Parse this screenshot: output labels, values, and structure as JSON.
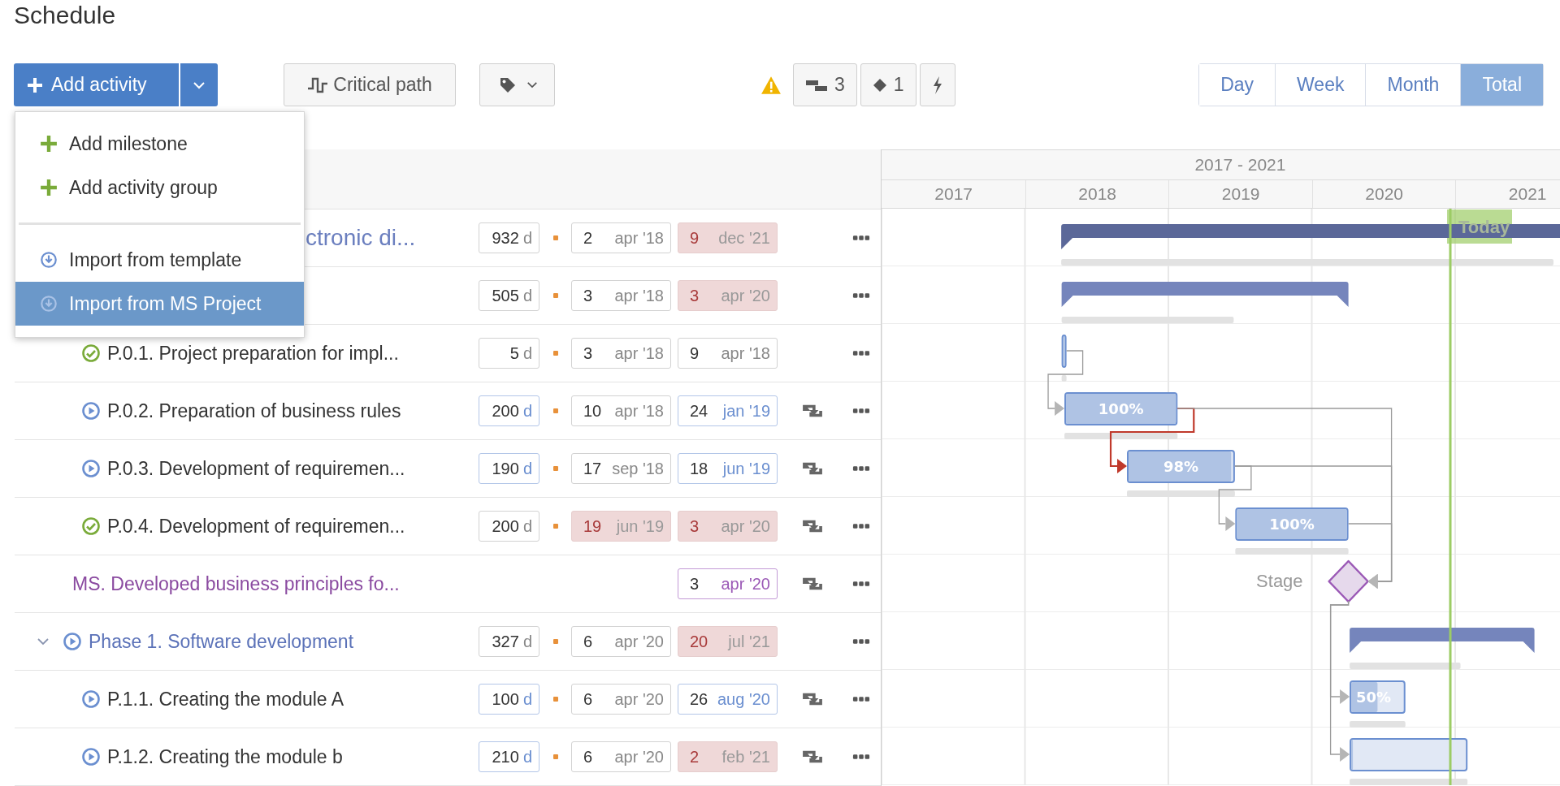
{
  "title": "Schedule",
  "toolbar": {
    "add_button": "Add activity",
    "critical_path": "Critical path",
    "counters": [
      {
        "kind": "bars",
        "count": "3"
      },
      {
        "kind": "milestone",
        "count": "1"
      },
      {
        "kind": "flash"
      }
    ],
    "views": [
      {
        "label": "Day",
        "selected": false
      },
      {
        "label": "Week",
        "selected": false
      },
      {
        "label": "Month",
        "selected": false
      },
      {
        "label": "Total",
        "selected": true
      }
    ]
  },
  "add_menu": {
    "groups": [
      [
        {
          "kind": "add",
          "label": "Add milestone",
          "selected": false
        },
        {
          "kind": "add",
          "label": "Add activity group",
          "selected": false
        }
      ],
      [
        {
          "kind": "import",
          "label": "Import from template",
          "selected": false
        },
        {
          "kind": "import",
          "label": "Import from MS Project",
          "selected": true
        }
      ]
    ]
  },
  "rows": [
    {
      "kind": "project",
      "name": "ctronic di...",
      "duration": {
        "value": "932",
        "unit": "d",
        "forecast": false
      },
      "start": {
        "day": "2",
        "month": "apr '18",
        "late": false,
        "forecast": false
      },
      "end": {
        "day": "9",
        "month": "dec '21",
        "late": true,
        "forecast": false
      },
      "repeat": false
    },
    {
      "kind": "group",
      "duration": {
        "value": "505",
        "unit": "d",
        "forecast": false
      },
      "start": {
        "day": "3",
        "month": "apr '18",
        "late": false,
        "forecast": false
      },
      "end": {
        "day": "3",
        "month": "apr '20",
        "late": true,
        "forecast": false
      },
      "repeat": false
    },
    {
      "kind": "task",
      "done": true,
      "name": "P.0.1. Project preparation for impl...",
      "duration": {
        "value": "5",
        "unit": "d",
        "forecast": false
      },
      "start": {
        "day": "3",
        "month": "apr '18",
        "late": false,
        "forecast": false
      },
      "end": {
        "day": "9",
        "month": "apr '18",
        "late": false,
        "forecast": false
      },
      "repeat": false,
      "bar": {
        "level": 1
      }
    },
    {
      "kind": "task",
      "done": false,
      "name": "P.0.2. Preparation of business rules",
      "duration": {
        "value": "200",
        "unit": "d",
        "forecast": true
      },
      "start": {
        "day": "10",
        "month": "apr '18",
        "late": false,
        "forecast": false
      },
      "end": {
        "day": "24",
        "month": "jan '19",
        "late": false,
        "forecast": true
      },
      "repeat": true,
      "bar": {
        "label": "100%",
        "level": 1
      },
      "links_in": [
        {
          "critical": false,
          "from_milestone": false
        }
      ]
    },
    {
      "kind": "task",
      "done": false,
      "name": "P.0.3. Development of requiremen...",
      "duration": {
        "value": "190",
        "unit": "d",
        "forecast": true
      },
      "start": {
        "day": "17",
        "month": "sep '18",
        "late": false,
        "forecast": false
      },
      "end": {
        "day": "18",
        "month": "jun '19",
        "late": false,
        "forecast": true
      },
      "repeat": true,
      "bar": {
        "label": "98%",
        "level": 0.98
      },
      "links_in": [
        {
          "critical": true,
          "from_milestone": false
        }
      ]
    },
    {
      "kind": "task",
      "done": true,
      "name": "P.0.4. Development of requiremen...",
      "duration": {
        "value": "200",
        "unit": "d",
        "forecast": false
      },
      "start": {
        "day": "19",
        "month": "jun '19",
        "late": true,
        "forecast": false
      },
      "end": {
        "day": "3",
        "month": "apr '20",
        "late": true,
        "forecast": false
      },
      "repeat": true,
      "bar": {
        "label": "100%",
        "level": 1
      },
      "links_in": [
        {
          "critical": false,
          "from_milestone": false
        }
      ]
    },
    {
      "kind": "milestone",
      "name": "MS. Developed business principles fo...",
      "end": {
        "day": "3",
        "month": "apr '20",
        "late": false,
        "forecast": false
      },
      "repeat": true,
      "gantt_label": "Stage",
      "links_in": [
        {
          "critical": false,
          "from_milestone": false
        },
        {
          "critical": false,
          "from_milestone": false
        },
        {
          "critical": false,
          "from_milestone": false
        }
      ]
    },
    {
      "kind": "phase",
      "expanded": true,
      "done": false,
      "name": "Phase 1. Software development",
      "duration": {
        "value": "327",
        "unit": "d",
        "forecast": false
      },
      "start": {
        "day": "6",
        "month": "apr '20",
        "late": false,
        "forecast": false
      },
      "end": {
        "day": "20",
        "month": "jul '21",
        "late": true,
        "forecast": false
      },
      "repeat": false
    },
    {
      "kind": "task",
      "done": false,
      "name": "P.1.1. Creating the module A",
      "duration": {
        "value": "100",
        "unit": "d",
        "forecast": true
      },
      "start": {
        "day": "6",
        "month": "apr '20",
        "late": false,
        "forecast": false
      },
      "end": {
        "day": "26",
        "month": "aug '20",
        "late": false,
        "forecast": true
      },
      "repeat": true,
      "bar": {
        "label": "50%",
        "level": 0.5
      },
      "links_in": [
        {
          "critical": false,
          "from_milestone": true
        }
      ]
    },
    {
      "kind": "task",
      "done": false,
      "name": "P.1.2. Creating the module b",
      "duration": {
        "value": "210",
        "unit": "d",
        "forecast": true
      },
      "start": {
        "day": "6",
        "month": "apr '20",
        "late": false,
        "forecast": false
      },
      "end": {
        "day": "2",
        "month": "feb '21",
        "late": true,
        "forecast": false
      },
      "repeat": true,
      "bar": {
        "level": 0
      },
      "links_in": [
        {
          "critical": false,
          "from_milestone": true
        }
      ]
    }
  ],
  "gantt": {
    "range": "2017 - 2021",
    "years": [
      "2017",
      "2018",
      "2019",
      "2020",
      "2021"
    ],
    "today_label": "Today"
  }
}
